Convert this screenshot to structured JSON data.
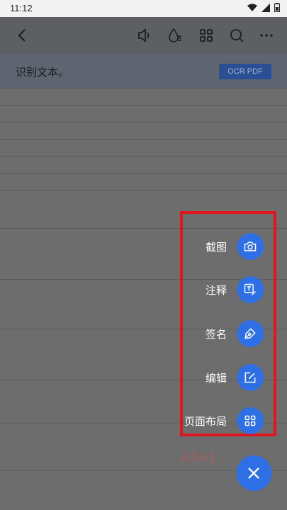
{
  "status_bar": {
    "time": "11:12"
  },
  "toolbar": {
    "icons": [
      "back-arrow-icon",
      "read-aloud-icon",
      "drop-icon",
      "grid-icon",
      "search-icon",
      "more-icon"
    ]
  },
  "ocr_banner": {
    "text": "识别文本。",
    "button_label": "OCR PDF"
  },
  "fab_menu": {
    "items": [
      {
        "label": "截图",
        "icon": "camera-icon"
      },
      {
        "label": "注释",
        "icon": "annotate-icon"
      },
      {
        "label": "签名",
        "icon": "pen-icon"
      },
      {
        "label": "编辑",
        "icon": "edit-icon"
      },
      {
        "label": "页面布局",
        "icon": "grid-icon"
      }
    ]
  },
  "close_fab": {
    "icon": "close-icon"
  },
  "colors": {
    "accent": "#2e6fe6",
    "highlight": "#e0161e"
  }
}
